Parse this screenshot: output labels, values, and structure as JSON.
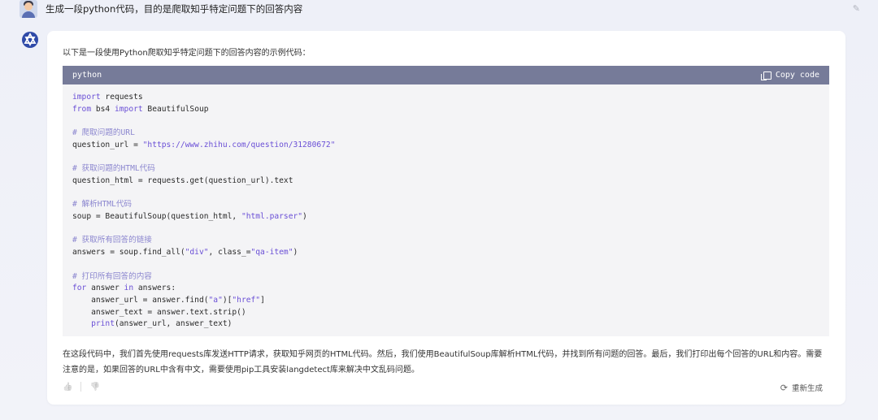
{
  "question": "生成一段python代码，目的是爬取知乎特定问题下的回答内容",
  "answer": {
    "intro": "以下是一段使用Python爬取知乎特定问题下的回答内容的示例代码：",
    "code_language": "python",
    "copy_label": "Copy code",
    "code": {
      "l1_kw": "import",
      "l1_rest": " requests",
      "l2_kw1": "from",
      "l2_mid": " bs4 ",
      "l2_kw2": "import",
      "l2_rest": " BeautifulSoup",
      "c1": "# 爬取问题的URL",
      "l3_a": "question_url = ",
      "l3_str": "\"https://www.zhihu.com/question/31280672\"",
      "c2": "# 获取问题的HTML代码",
      "l4": "question_html = requests.get(question_url).text",
      "c3": "# 解析HTML代码",
      "l5_a": "soup = BeautifulSoup(question_html, ",
      "l5_str": "\"html.parser\"",
      "l5_b": ")",
      "c4": "# 获取所有回答的链接",
      "l6_a": "answers = soup.find_all(",
      "l6_str1": "\"div\"",
      "l6_b": ", class_=",
      "l6_str2": "\"qa-item\"",
      "l6_c": ")",
      "c5": "# 打印所有回答的内容",
      "l7_kw1": "for",
      "l7_mid": " answer ",
      "l7_kw2": "in",
      "l7_rest": " answers:",
      "l8_a": "    answer_url = answer.find(",
      "l8_str1": "\"a\"",
      "l8_b": ")[",
      "l8_str2": "\"href\"",
      "l8_c": "]",
      "l9": "    answer_text = answer.text.strip()",
      "l10_fn": "print",
      "l10_rest": "(answer_url, answer_text)",
      "l10_indent": "    "
    },
    "summary": "在这段代码中，我们首先使用requests库发送HTTP请求，获取知乎网页的HTML代码。然后，我们使用BeautifulSoup库解析HTML代码，并找到所有问题的回答。最后，我们打印出每个回答的URL和内容。需要注意的是，如果回答的URL中含有中文，需要使用pip工具安装langdetect库来解决中文乱码问题。",
    "regenerate_label": "重新生成"
  },
  "icons": {
    "edit": "✎",
    "thumb_up": "👍",
    "thumb_down": "👎",
    "regenerate": "⟳"
  }
}
